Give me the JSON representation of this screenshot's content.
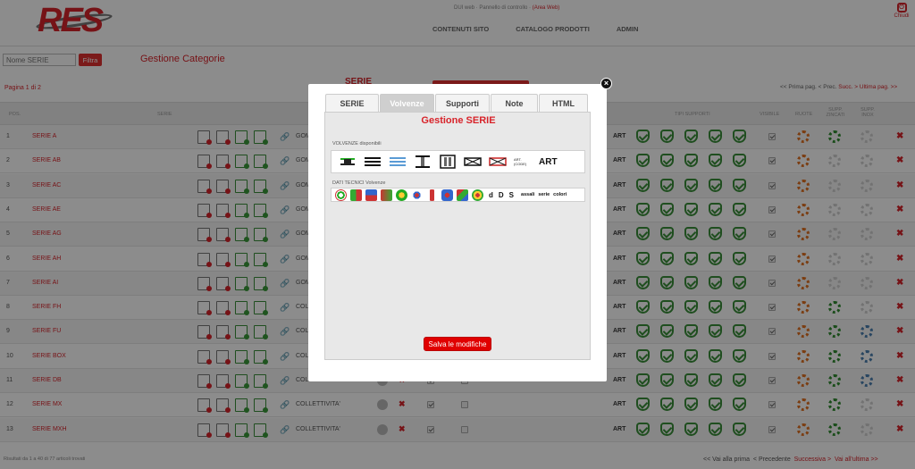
{
  "header": {
    "logo_text": "RES",
    "top_info": "DUI web · Pannello di controllo ·",
    "top_info_link": "(Area Web)",
    "nav": [
      "CONTENUTI SITO",
      "CATALOGO PRODOTTI",
      "ADMIN"
    ],
    "logout_label": "Chiudi"
  },
  "filter": {
    "placeholder": "Nome SERIE",
    "button_label": "Filtra"
  },
  "page_title": "Gestione Categorie",
  "pager": {
    "page_info": "Pagina 1 di 2",
    "first": "<< Prima pag.",
    "prev": "< Prec.",
    "next": "Succ. >",
    "last": "Ultima pag. >>"
  },
  "serie_heading": "SERIE",
  "table": {
    "headers": {
      "pos": "Pos.",
      "serie": "SERIE",
      "tipi_supporti": "TIPI SUPPORTI",
      "visibile": "VISIBILE",
      "ruote": "RUOTE",
      "supp_zincati": "SUPP. ZINCATI",
      "supp_inox": "SUPP. INOX"
    },
    "art_label": "ART",
    "rows": [
      {
        "pos": "1",
        "name": "SERIE A",
        "cat": "GOM"
      },
      {
        "pos": "2",
        "name": "SERIE AB",
        "cat": "GOM"
      },
      {
        "pos": "3",
        "name": "SERIE AC",
        "cat": "GOM"
      },
      {
        "pos": "4",
        "name": "SERIE AE",
        "cat": "GOM"
      },
      {
        "pos": "5",
        "name": "SERIE AG",
        "cat": "GOM"
      },
      {
        "pos": "6",
        "name": "SERIE AH",
        "cat": "GOM"
      },
      {
        "pos": "7",
        "name": "SERIE AI",
        "cat": "GOM"
      },
      {
        "pos": "8",
        "name": "SERIE FH",
        "cat": "COLL"
      },
      {
        "pos": "9",
        "name": "SERIE FU",
        "cat": "COLL"
      },
      {
        "pos": "10",
        "name": "SERIE BOX",
        "cat": "COLL"
      },
      {
        "pos": "11",
        "name": "SERIE DB",
        "cat": "COLLETTIVITA'"
      },
      {
        "pos": "12",
        "name": "SERIE MX",
        "cat": "COLLETTIVITA'"
      },
      {
        "pos": "13",
        "name": "SERIE MXH",
        "cat": "COLLETTIVITA'"
      }
    ]
  },
  "footer": {
    "info": "Risultati da 1 a 40 di 77 articoli trovati",
    "first": "<< Vai alla prima",
    "prev": "< Precedente",
    "next": "Successiva >",
    "last": "Vai all'ultima >>"
  },
  "modal": {
    "close_glyph": "×",
    "tabs": [
      "SERIE",
      "Volvenze",
      "Supporti",
      "Note",
      "HTML"
    ],
    "active_tab": "Volvenze",
    "title": "Gestione SERIE",
    "volvenze_label": "VOLVENZE disponibili",
    "volvenze_art_small": "ART.(CODE)",
    "volvenze_art": "ART",
    "dati_label": "DATI TECNICI Volvenze",
    "dati_letters": [
      "d",
      "D",
      "S"
    ],
    "dati_words": [
      "assali",
      "serie",
      "colori"
    ],
    "save_label": "Salva le modifiche"
  },
  "colors": {
    "accent": "#d8232a",
    "ok_green": "#3a8f3a",
    "overlay": "rgba(0,0,0,0.45)"
  }
}
